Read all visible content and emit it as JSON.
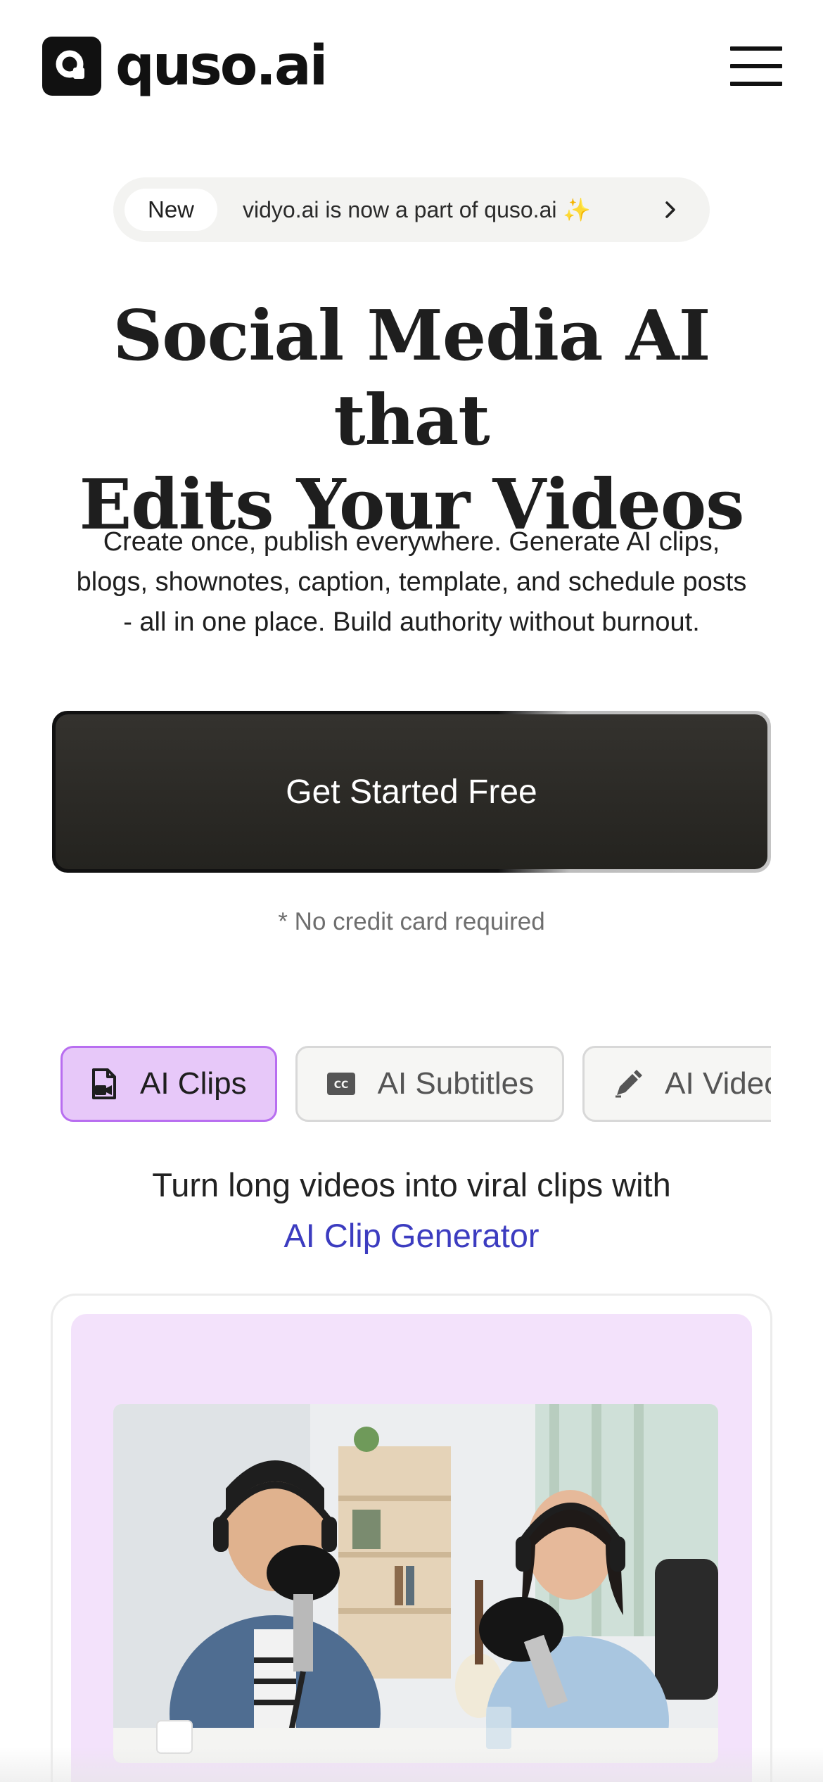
{
  "header": {
    "logo_text": "quso.ai",
    "menu_icon": "hamburger-menu-icon"
  },
  "announcement": {
    "badge": "New",
    "text": "vidyo.ai is now a part of quso.ai ✨",
    "chevron_icon": "chevron-right-icon"
  },
  "hero": {
    "title_line1": "Social Media AI that",
    "title_line2": "Edits Your Videos",
    "subtitle_line1": "Create once, publish everywhere. Generate AI clips,",
    "subtitle_line2": "blogs, shownotes, caption, template, and schedule posts",
    "subtitle_line3": "- all in one place. Build authority without burnout."
  },
  "cta": {
    "label": "Get Started Free",
    "note": "* No credit card required"
  },
  "tabs": [
    {
      "label": "AI Clips",
      "icon": "video-file-icon",
      "active": true
    },
    {
      "label": "AI Subtitles",
      "icon": "closed-captions-icon",
      "active": false
    },
    {
      "label": "AI Video",
      "icon": "magic-pen-icon",
      "active": false
    }
  ],
  "feature": {
    "tagline": "Turn long videos into viral clips with",
    "accent": "AI Clip Generator"
  },
  "colors": {
    "accent_blue": "#3c3cc0",
    "active_tab_bg": "#e7c8f9",
    "active_tab_border": "#b86ef0",
    "card_bg": "#f3e2fb",
    "cta_bg": "#24231f"
  }
}
